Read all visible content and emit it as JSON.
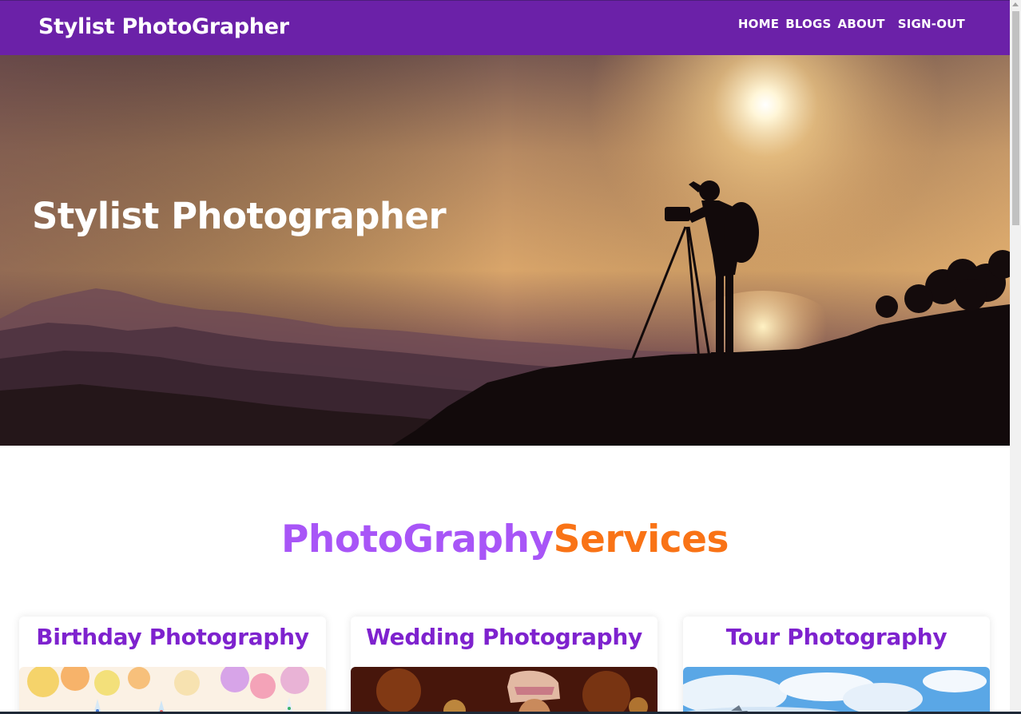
{
  "navbar": {
    "brand": "Stylist PhotoGrapher",
    "links": [
      {
        "label": "HOME"
      },
      {
        "label": "BLOGS"
      },
      {
        "label": "ABOUT"
      },
      {
        "label": "SIGN-OUT"
      }
    ],
    "bg_color": "#6b21a8"
  },
  "hero": {
    "title": "Stylist Photographer"
  },
  "services": {
    "title_part1": "PhotoGraphy",
    "title_part2": "Services",
    "title_part1_color": "#a855f7",
    "title_part2_color": "#f97316",
    "cards": [
      {
        "title": "Birthday Photography"
      },
      {
        "title": "Wedding Photography"
      },
      {
        "title": "Tour Photography"
      }
    ]
  }
}
